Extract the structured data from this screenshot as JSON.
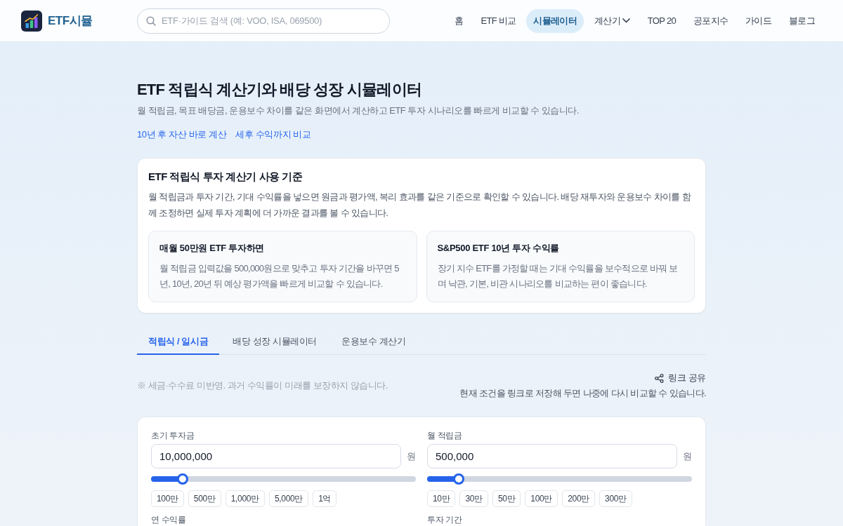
{
  "header": {
    "logo_text": "ETF시뮬",
    "search": {
      "placeholder": "ETF·가이드 검색 (예: VOO, ISA, 069500)"
    },
    "nav": [
      {
        "label": "홈",
        "kind": "link",
        "selected": false
      },
      {
        "label": "ETF 비교",
        "kind": "link",
        "selected": false
      },
      {
        "label": "시뮬레이터",
        "kind": "link",
        "selected": true
      },
      {
        "label": "계산기",
        "kind": "dropdown",
        "selected": false
      },
      {
        "label": "TOP 20",
        "kind": "link",
        "selected": false
      },
      {
        "label": "공포지수",
        "kind": "link",
        "selected": false
      },
      {
        "label": "가이드",
        "kind": "link",
        "selected": false
      },
      {
        "label": "블로그",
        "kind": "link",
        "selected": false
      }
    ]
  },
  "hero": {
    "title": "ETF 적립식 계산기와 배당 성장 시뮬레이터",
    "subtitle": "월 적립금, 목표 배당금, 운용보수 차이를 같은 화면에서 계산하고 ETF 투자 시나리오를 빠르게 비교할 수 있습니다.",
    "links": [
      "10년 후 자산 바로 계산",
      "세후 수익까지 비교"
    ]
  },
  "guide_card": {
    "title": "ETF 적립식 투자 계산기 사용 기준",
    "body": "월 적립금과 투자 기간, 기대 수익률을 넣으면 원금과 평가액, 복리 효과를 같은 기준으로 확인할 수 있습니다. 배당 재투자와 운용보수 차이를 함께 조정하면 실제 투자 계획에 더 가까운 결과를 볼 수 있습니다.",
    "examples": [
      {
        "title": "매월 50만원 ETF 투자하면",
        "text": "월 적립금 입력값을 500,000원으로 맞추고 투자 기간을 바꾸면 5년, 10년, 20년 뒤 예상 평가액을 빠르게 비교할 수 있습니다."
      },
      {
        "title": "S&P500 ETF 10년 투자 수익률",
        "text": "장기 지수 ETF를 가정할 때는 기대 수익률을 보수적으로 바꿔 보며 낙관, 기본, 비관 시나리오를 비교하는 편이 좋습니다."
      }
    ]
  },
  "tabs": [
    {
      "label": "적립식 / 일시금",
      "selected": true
    },
    {
      "label": "배당 성장 시뮬레이터",
      "selected": false
    },
    {
      "label": "운용보수 계산기",
      "selected": false
    }
  ],
  "notice": "※ 세금·수수료 미반영. 과거 수익률이 미래를 보장하지 않습니다.",
  "share": {
    "label": "링크 공유",
    "hint": "현재 조건을 링크로 저장해 두면 나중에 다시 비교할 수 있습니다."
  },
  "form": {
    "fields": [
      {
        "label": "초기 투자금",
        "value": "10,000,000",
        "unit": "원",
        "level": 0.12,
        "presets": [
          "100만",
          "500만",
          "1,000만",
          "5,000만",
          "1억"
        ]
      },
      {
        "label": "월 적립금",
        "value": "500,000",
        "unit": "원",
        "level": 0.12,
        "presets": [
          "10만",
          "30만",
          "50만",
          "100만",
          "200만",
          "300만"
        ]
      }
    ],
    "more_fields": [
      {
        "label": "연 수익률"
      },
      {
        "label": "투자 기간"
      }
    ]
  }
}
